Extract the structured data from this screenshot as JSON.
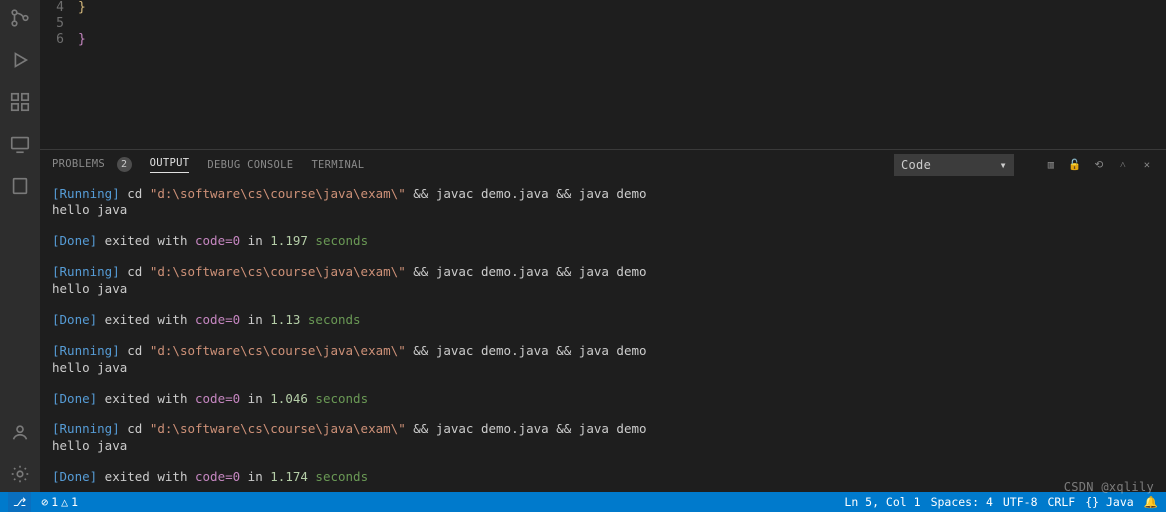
{
  "editor": {
    "lines": [
      {
        "num": "4",
        "text": "}",
        "cls": "brace-y"
      },
      {
        "num": "5",
        "text": "",
        "cls": ""
      },
      {
        "num": "6",
        "text": "}",
        "cls": "brace-p"
      }
    ]
  },
  "panel": {
    "tabs": {
      "problems": "PROBLEMS",
      "problems_badge": "2",
      "output": "OUTPUT",
      "debug": "DEBUG CONSOLE",
      "terminal": "TERMINAL"
    },
    "select_value": "Code"
  },
  "output": {
    "run_label": "[Running]",
    "done_label": "[Done]",
    "run_prefix": " cd ",
    "run_path": "\"d:\\software\\cs\\course\\java\\exam\\\"",
    "run_rest": " && javac demo.java && java demo",
    "hello": "hello java",
    "done_a": " exited with ",
    "done_key": "code=0",
    "done_b": " in ",
    "done_unit": " seconds",
    "runs": [
      {
        "time": "1.197"
      },
      {
        "time": "1.13"
      },
      {
        "time": "1.046"
      },
      {
        "time": "1.174"
      }
    ]
  },
  "status": {
    "remote": "⎇",
    "errors_icon": "⊘",
    "errors": "1",
    "warn_icon": "△",
    "warnings": "1",
    "ln_col": "Ln 5, Col 1",
    "spaces": "Spaces: 4",
    "encoding": "UTF-8",
    "eol": "CRLF",
    "lang": "{} Java",
    "bell": "🔔"
  },
  "watermark": "CSDN @xqlily"
}
